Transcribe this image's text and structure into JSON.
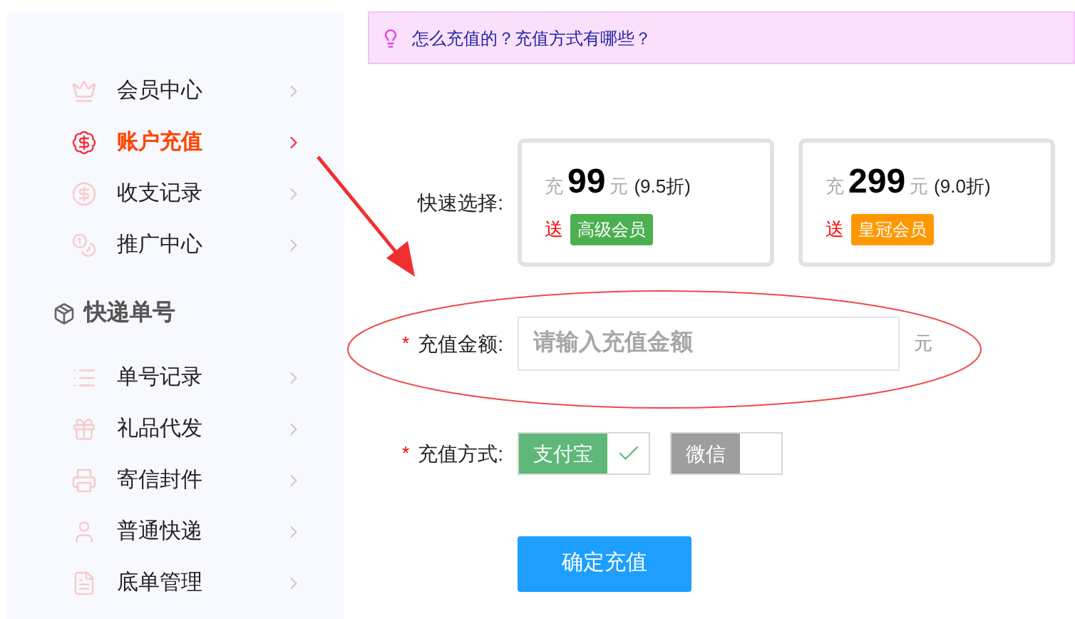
{
  "sidebar": {
    "groups": [
      {
        "items": [
          {
            "label": "会员中心",
            "selected": false
          },
          {
            "label": "账户充值",
            "selected": true
          },
          {
            "label": "收支记录",
            "selected": false
          },
          {
            "label": "推广中心",
            "selected": false
          }
        ]
      },
      {
        "heading": "快递单号",
        "items": [
          {
            "label": "单号记录",
            "selected": false
          },
          {
            "label": "礼品代发",
            "selected": false
          },
          {
            "label": "寄信封件",
            "selected": false
          },
          {
            "label": "普通快递",
            "selected": false
          },
          {
            "label": "底单管理",
            "selected": false
          }
        ]
      }
    ]
  },
  "notice": "怎么充值的？充值方式有哪些？",
  "quick_select": {
    "label": "快速选择:",
    "options": [
      {
        "prefix": "充",
        "amount": "99",
        "unit": "元",
        "discount": "(9.5折)",
        "gift_prefix": "送",
        "gift": "高级会员",
        "color": "#4caf50"
      },
      {
        "prefix": "充",
        "amount": "299",
        "unit": "元",
        "discount": "(9.0折)",
        "gift_prefix": "送",
        "gift": "皇冠会员",
        "color": "#ff9800"
      }
    ]
  },
  "amount_field": {
    "required_mark": "*",
    "label": "充值金额:",
    "placeholder": "请输入充值金额",
    "unit": "元"
  },
  "payment": {
    "required_mark": "*",
    "label": "充值方式:",
    "methods": [
      {
        "label": "支付宝",
        "selected": true
      },
      {
        "label": "微信",
        "selected": false
      }
    ]
  },
  "submit": "确定充值"
}
